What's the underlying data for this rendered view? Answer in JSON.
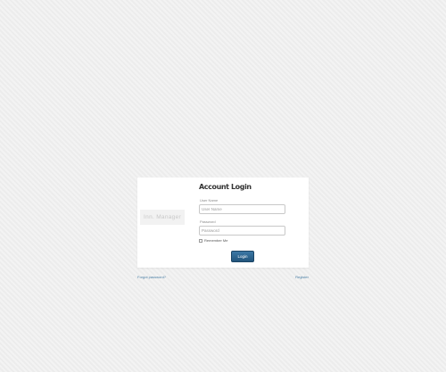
{
  "login": {
    "logo_text": "Inn. Manager",
    "title": "Account Login",
    "username_label": "User Name",
    "username_placeholder": "User Name",
    "password_label": "Password",
    "password_placeholder": "Password",
    "remember_label": "Remember Me",
    "remember_checked": false,
    "submit_label": "Login"
  },
  "footer": {
    "forgot_link": "Forgot password?",
    "register_link": "Register"
  },
  "colors": {
    "page_background": "#efefef",
    "panel_background": "#ffffff",
    "button_color": "#2c6690",
    "link_color": "#4a7fa5"
  }
}
